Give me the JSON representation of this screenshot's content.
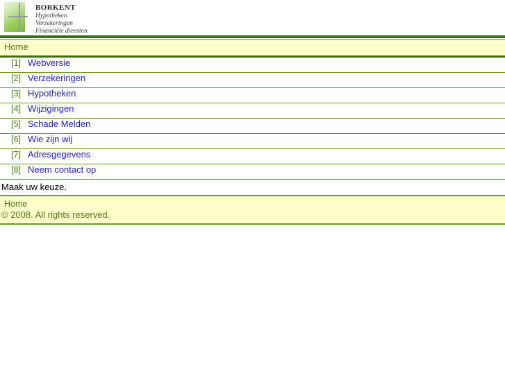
{
  "brand": {
    "name": "BORKENT",
    "lines": [
      "Hypotheken",
      "Verzekeringen",
      "Financiële diensten"
    ],
    "logo_icon": "green-square-cross-icon"
  },
  "page": {
    "title": "Home"
  },
  "menu": {
    "items": [
      {
        "index": "[1]",
        "label": "Webversie"
      },
      {
        "index": "[2]",
        "label": "Verzekeringen"
      },
      {
        "index": "[3]",
        "label": "Hypotheken"
      },
      {
        "index": "[4]",
        "label": "Wijzigingen"
      },
      {
        "index": "[5]",
        "label": "Schade Melden"
      },
      {
        "index": "[6]",
        "label": "Wie zijn wij"
      },
      {
        "index": "[7]",
        "label": "Adresgegevens"
      },
      {
        "index": "[8]",
        "label": "Neem contact op"
      }
    ]
  },
  "prompt": {
    "text": "Maak uw keuze."
  },
  "footer": {
    "home_label": "Home",
    "copyright": "© 2008. All rights reserved."
  },
  "colors": {
    "accent_green": "#3c6e0a",
    "border_green": "#6a9e1e",
    "band_background": "#ffffcc",
    "link_blue": "#2222cc",
    "label_green": "#4a7c10"
  }
}
